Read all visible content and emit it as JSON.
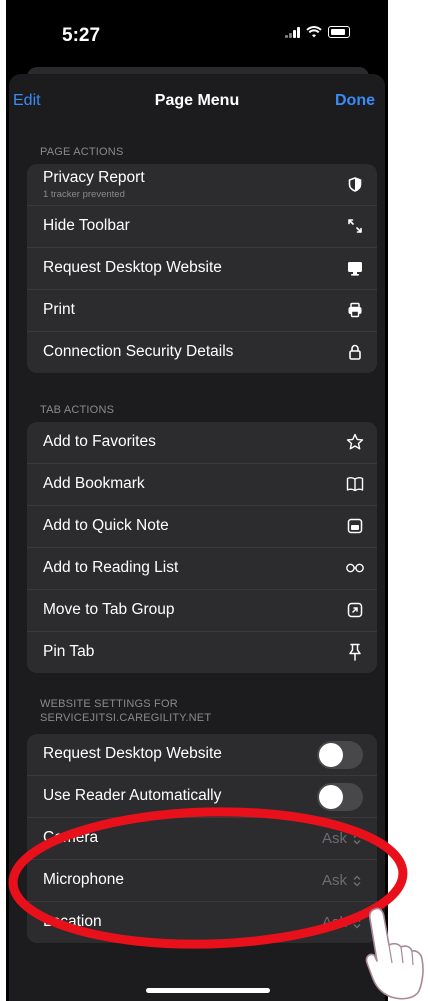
{
  "status_bar": {
    "time": "5:27"
  },
  "nav": {
    "edit": "Edit",
    "title": "Page Menu",
    "done": "Done"
  },
  "page_actions": {
    "header": "PAGE ACTIONS",
    "items": [
      {
        "label": "Privacy Report",
        "sub": "1 tracker prevented",
        "icon": "privacy-shield-icon"
      },
      {
        "label": "Hide Toolbar",
        "icon": "resize-arrows-icon"
      },
      {
        "label": "Request Desktop Website",
        "icon": "desktop-monitor-icon"
      },
      {
        "label": "Print",
        "icon": "printer-icon"
      },
      {
        "label": "Connection Security Details",
        "icon": "lock-icon"
      }
    ]
  },
  "tab_actions": {
    "header": "TAB ACTIONS",
    "items": [
      {
        "label": "Add to Favorites",
        "icon": "star-icon"
      },
      {
        "label": "Add Bookmark",
        "icon": "book-icon"
      },
      {
        "label": "Add to Quick Note",
        "icon": "quick-note-icon"
      },
      {
        "label": "Add to Reading List",
        "icon": "glasses-icon"
      },
      {
        "label": "Move to Tab Group",
        "icon": "tab-group-icon"
      },
      {
        "label": "Pin Tab",
        "icon": "pin-icon"
      }
    ]
  },
  "website_settings": {
    "header_line1": "WEBSITE SETTINGS FOR",
    "header_line2": "SERVICEJITSI.CAREGILITY.NET",
    "toggles": [
      {
        "label": "Request Desktop Website",
        "state": "off"
      },
      {
        "label": "Use Reader Automatically",
        "state": "off"
      }
    ],
    "permissions": [
      {
        "label": "Camera",
        "value": "Ask"
      },
      {
        "label": "Microphone",
        "value": "Ask"
      },
      {
        "label": "Location",
        "value": "Ask"
      }
    ]
  },
  "colors": {
    "accent": "#3a8bf5",
    "annotation_ring": "#e8101a",
    "sheet_bg": "#1c1c1e",
    "group_bg": "#2c2c2e"
  }
}
